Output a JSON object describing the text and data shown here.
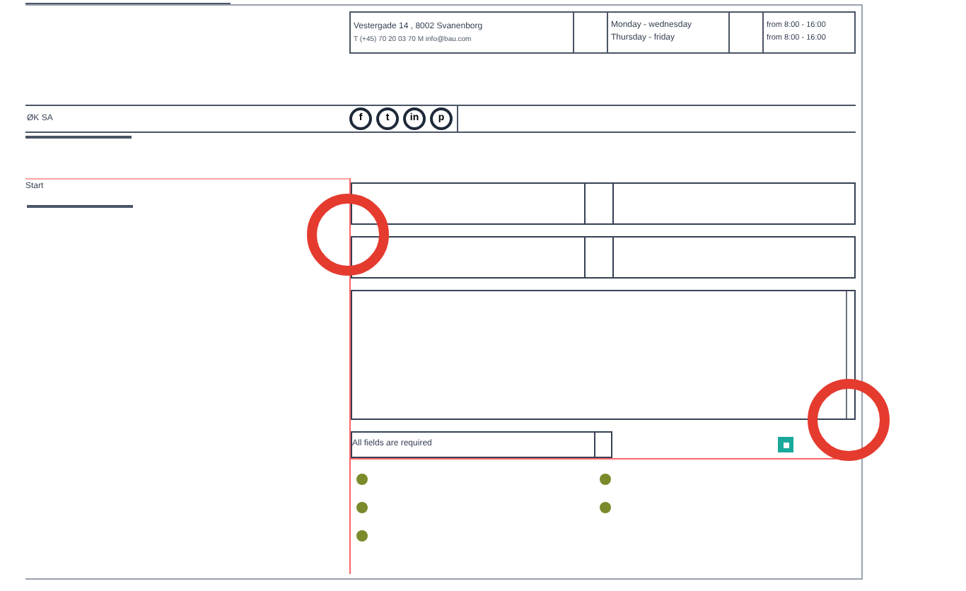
{
  "contact": {
    "address": "Vestergade 14 , 8002 Svanenborg",
    "phone_mail": "T (+45) 70 20 03 70   M info@bau.com",
    "hours": [
      {
        "days": "Monday - wednesday",
        "time": "from 8:00 - 16:00"
      },
      {
        "days": "Thursday - friday",
        "time": "from 8:00 - 16:00"
      }
    ]
  },
  "footer_row": {
    "label": "ØK SA",
    "social": [
      "f",
      "t",
      "in",
      "p"
    ]
  },
  "form": {
    "label": "Start",
    "required_note": "All fields are required",
    "consent_checked": true,
    "bullets": [
      {
        "kind": "dot"
      },
      {
        "kind": "dot"
      },
      {
        "kind": "dot"
      },
      {
        "kind": "dot"
      },
      {
        "kind": "dot"
      }
    ]
  },
  "annotations": [
    {
      "kind": "circle"
    },
    {
      "kind": "circle"
    }
  ]
}
